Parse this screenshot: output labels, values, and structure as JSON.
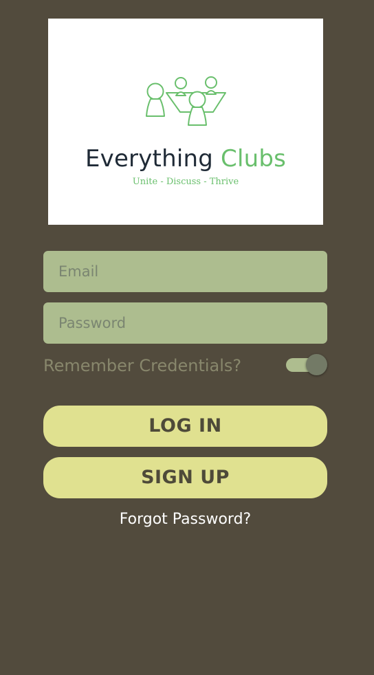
{
  "logo": {
    "brand_part1": "Everything",
    "brand_part2": "Clubs",
    "tagline": "Unite - Discuss - Thrive",
    "icon": "club-members-table-icon"
  },
  "form": {
    "email_placeholder": "Email",
    "email_value": "",
    "password_placeholder": "Password",
    "password_value": "",
    "remember_label": "Remember Credentials?",
    "remember_on": true
  },
  "buttons": {
    "login_label": "LOG IN",
    "signup_label": "SIGN UP",
    "forgot_label": "Forgot Password?"
  },
  "colors": {
    "background": "#524b3d",
    "field": "#adbd8f",
    "button": "#e0e190",
    "brand_green": "#69bf6c",
    "brand_dark": "#1f2a36"
  }
}
